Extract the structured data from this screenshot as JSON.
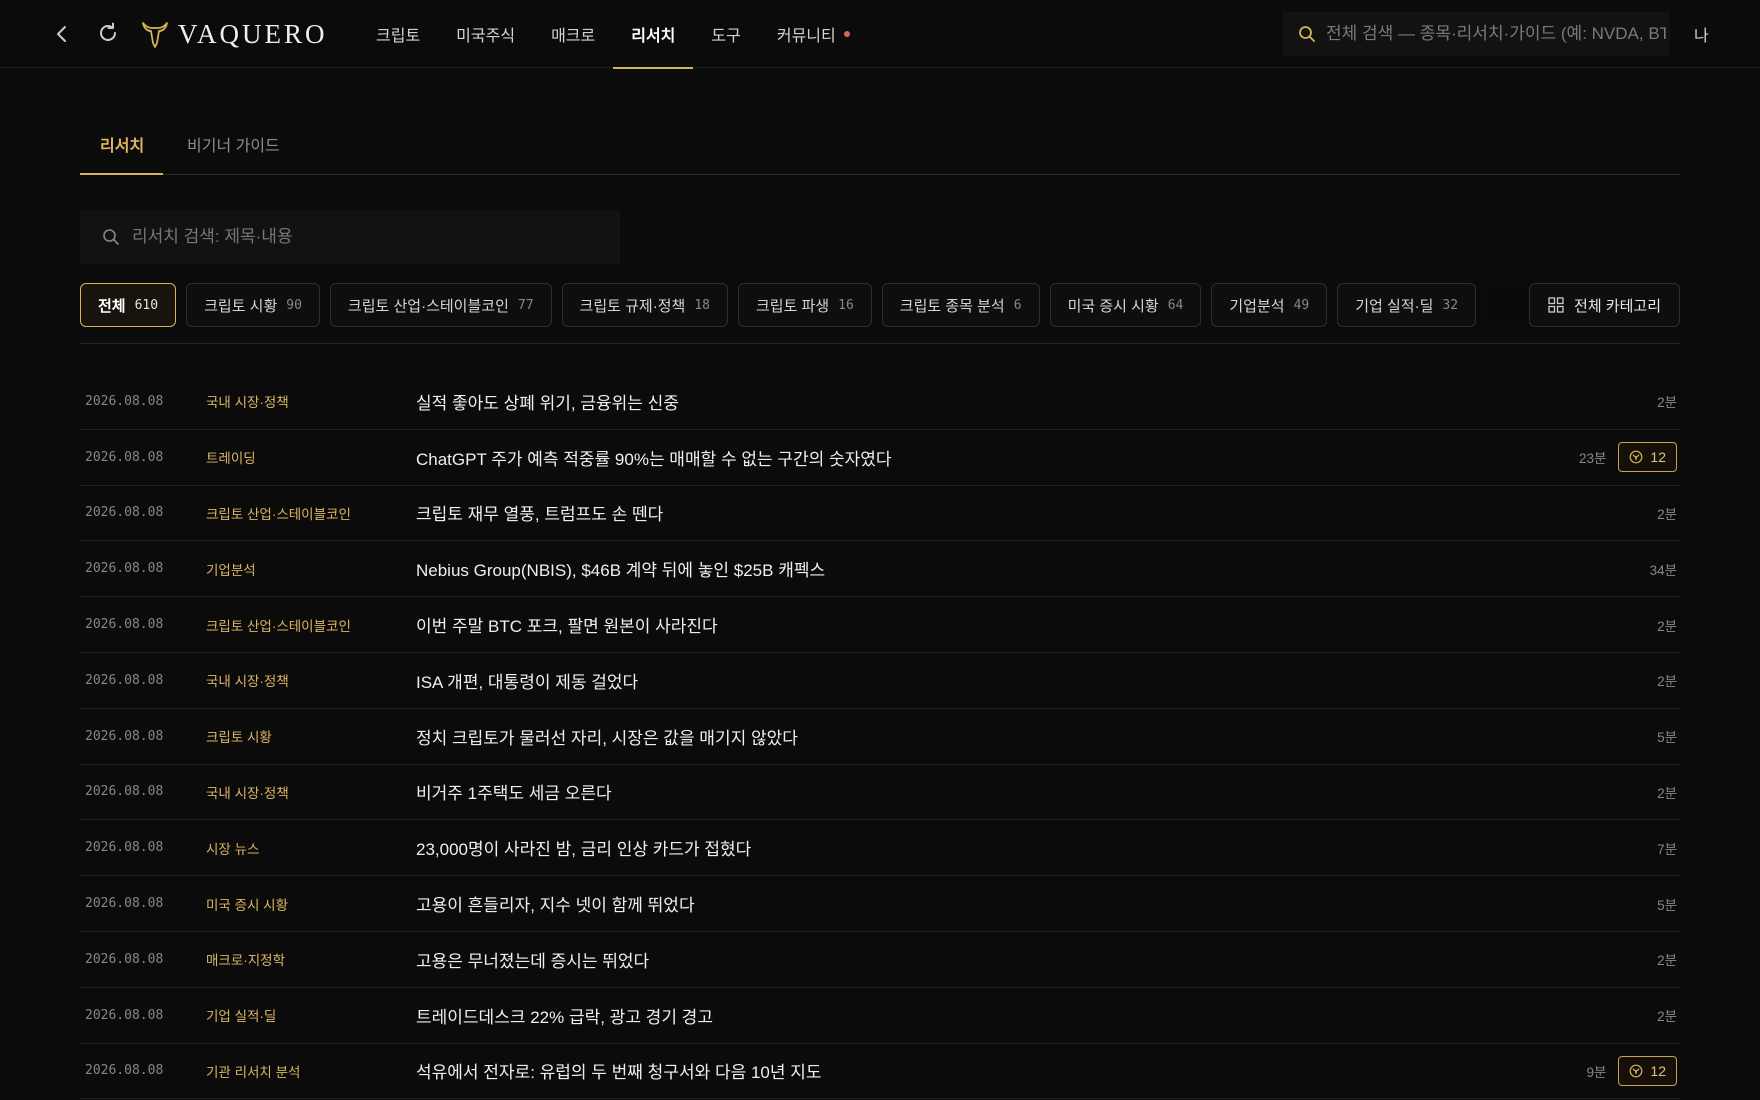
{
  "header": {
    "brand": "VAQUERO",
    "nav": [
      {
        "label": "크립토"
      },
      {
        "label": "미국주식"
      },
      {
        "label": "매크로"
      },
      {
        "label": "리서치"
      },
      {
        "label": "도구"
      },
      {
        "label": "커뮤니티"
      }
    ],
    "active_nav": "리서치",
    "community_has_notification": true,
    "search_placeholder": "전체 검색 — 종목·리서치·가이드 (예: NVDA, BTC)",
    "user_label": "나"
  },
  "subtabs": [
    {
      "label": "리서치"
    },
    {
      "label": "비기너 가이드"
    }
  ],
  "research_search_placeholder": "리서치 검색: 제목·내용",
  "categories": [
    {
      "label": "전체",
      "count": "610"
    },
    {
      "label": "크립토 시황",
      "count": "90"
    },
    {
      "label": "크립토 산업·스테이블코인",
      "count": "77"
    },
    {
      "label": "크립토 규제·정책",
      "count": "18"
    },
    {
      "label": "크립토 파생",
      "count": "16"
    },
    {
      "label": "크립토 종목 분석",
      "count": "6"
    },
    {
      "label": "미국 증시 시황",
      "count": "64"
    },
    {
      "label": "기업분석",
      "count": "49"
    },
    {
      "label": "기업 실적·딜",
      "count": "32"
    }
  ],
  "all_categories_label": "전체 카테고리",
  "articles": [
    {
      "date": "2026.08.08",
      "category": "국내 시장·정책",
      "title": "실적 좋아도 상폐 위기, 금융위는 신중",
      "read_time": "2분",
      "badge": ""
    },
    {
      "date": "2026.08.08",
      "category": "트레이딩",
      "title": "ChatGPT 주가 예측 적중률 90%는 매매할 수 없는 구간의 숫자였다",
      "read_time": "23분",
      "badge": "12"
    },
    {
      "date": "2026.08.08",
      "category": "크립토 산업·스테이블코인",
      "title": "크립토 재무 열풍, 트럼프도 손 뗀다",
      "read_time": "2분",
      "badge": ""
    },
    {
      "date": "2026.08.08",
      "category": "기업분석",
      "title": "Nebius Group(NBIS), $46B 계약 뒤에 놓인 $25B 캐펙스",
      "read_time": "34분",
      "badge": ""
    },
    {
      "date": "2026.08.08",
      "category": "크립토 산업·스테이블코인",
      "title": "이번 주말 BTC 포크, 팔면 원본이 사라진다",
      "read_time": "2분",
      "badge": ""
    },
    {
      "date": "2026.08.08",
      "category": "국내 시장·정책",
      "title": "ISA 개편, 대통령이 제동 걸었다",
      "read_time": "2분",
      "badge": ""
    },
    {
      "date": "2026.08.08",
      "category": "크립토 시황",
      "title": "정치 크립토가 물러선 자리, 시장은 값을 매기지 않았다",
      "read_time": "5분",
      "badge": ""
    },
    {
      "date": "2026.08.08",
      "category": "국내 시장·정책",
      "title": "비거주 1주택도 세금 오른다",
      "read_time": "2분",
      "badge": ""
    },
    {
      "date": "2026.08.08",
      "category": "시장 뉴스",
      "title": "23,000명이 사라진 밤, 금리 인상 카드가 접혔다",
      "read_time": "7분",
      "badge": ""
    },
    {
      "date": "2026.08.08",
      "category": "미국 증시 시황",
      "title": "고용이 흔들리자, 지수 넷이 함께 뛰었다",
      "read_time": "5분",
      "badge": ""
    },
    {
      "date": "2026.08.08",
      "category": "매크로·지정학",
      "title": "고용은 무너졌는데 증시는 뛰었다",
      "read_time": "2분",
      "badge": ""
    },
    {
      "date": "2026.08.08",
      "category": "기업 실적·딜",
      "title": "트레이드데스크 22% 급락, 광고 경기 경고",
      "read_time": "2분",
      "badge": ""
    },
    {
      "date": "2026.08.08",
      "category": "기관 리서치 분석",
      "title": "석유에서 전자로: 유럽의 두 번째 청구서와 다음 10년 지도",
      "read_time": "9분",
      "badge": "12"
    }
  ],
  "colors": {
    "background": "#0b0b0b",
    "accent_gold": "#d8b25a",
    "notification_dot": "#e0605a"
  }
}
